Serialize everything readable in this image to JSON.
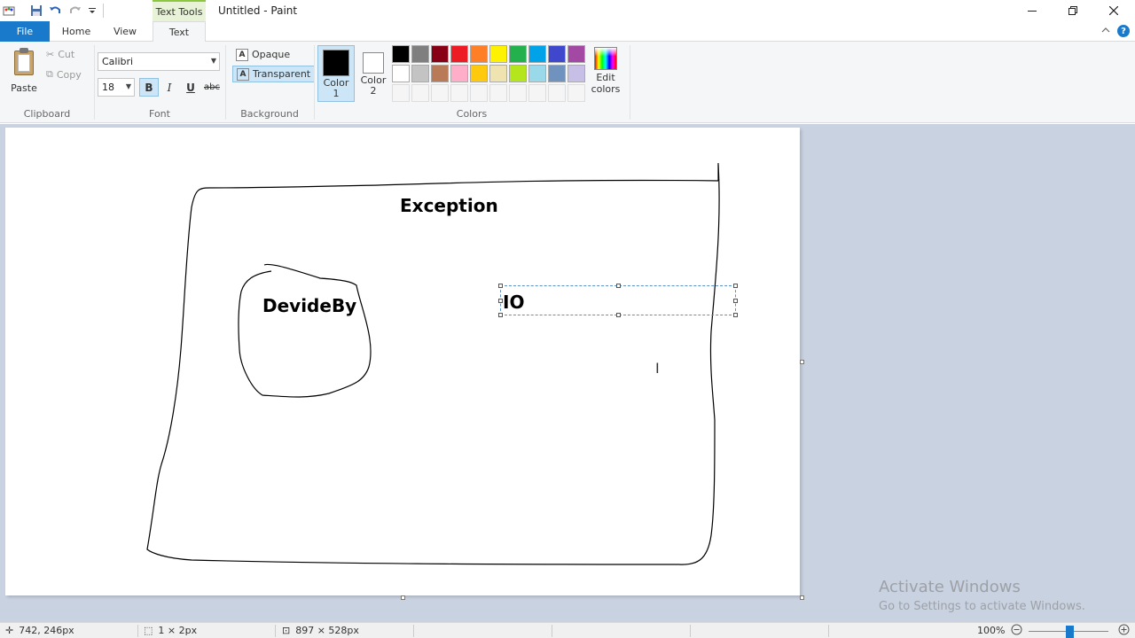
{
  "titlebar": {
    "title": "Untitled - Paint",
    "contextual_group": "Text Tools",
    "qat": [
      "paint-app-icon",
      "save-icon",
      "undo-icon",
      "redo-icon",
      "customize-qat-icon"
    ]
  },
  "tabs": {
    "file": "File",
    "home": "Home",
    "view": "View",
    "text": "Text",
    "active": "Text"
  },
  "ribbon": {
    "clipboard": {
      "label": "Clipboard",
      "paste": "Paste",
      "cut": "Cut",
      "copy": "Copy"
    },
    "font": {
      "label": "Font",
      "family": "Calibri",
      "size": "18",
      "bold": "B",
      "italic": "I",
      "underline": "U",
      "strike": "abc",
      "bold_active": true
    },
    "background": {
      "label": "Background",
      "opaque": "Opaque",
      "transparent": "Transparent",
      "selected": "Transparent"
    },
    "colors": {
      "label": "Colors",
      "color1_label": "Color",
      "color1_num": "1",
      "color1_value": "#000000",
      "color2_label": "Color",
      "color2_num": "2",
      "color2_value": "#ffffff",
      "edit_label_1": "Edit",
      "edit_label_2": "colors",
      "palette": [
        "#000000",
        "#7f7f7f",
        "#880015",
        "#ed1c24",
        "#ff7f27",
        "#fff200",
        "#22b14c",
        "#00a2e8",
        "#3f48cc",
        "#a349a4",
        "#ffffff",
        "#c3c3c3",
        "#b97a57",
        "#ffaec9",
        "#ffc90e",
        "#efe4b0",
        "#b5e61d",
        "#99d9ea",
        "#7092be",
        "#c8bfe7",
        "#f5f5f5",
        "#f5f5f5",
        "#f5f5f5",
        "#f5f5f5",
        "#f5f5f5",
        "#f5f5f5",
        "#f5f5f5",
        "#f5f5f5",
        "#f5f5f5",
        "#f5f5f5"
      ]
    }
  },
  "canvas": {
    "texts": {
      "exception": "Exception",
      "devideby": "DevideBy",
      "io": "IO"
    }
  },
  "watermark": {
    "title": "Activate Windows",
    "subtitle": "Go to Settings to activate Windows."
  },
  "statusbar": {
    "cursor_pos": "742, 246px",
    "selection_size": "1 × 2px",
    "canvas_size": "897 × 528px",
    "zoom": "100%",
    "zoom_level": 1.0
  }
}
